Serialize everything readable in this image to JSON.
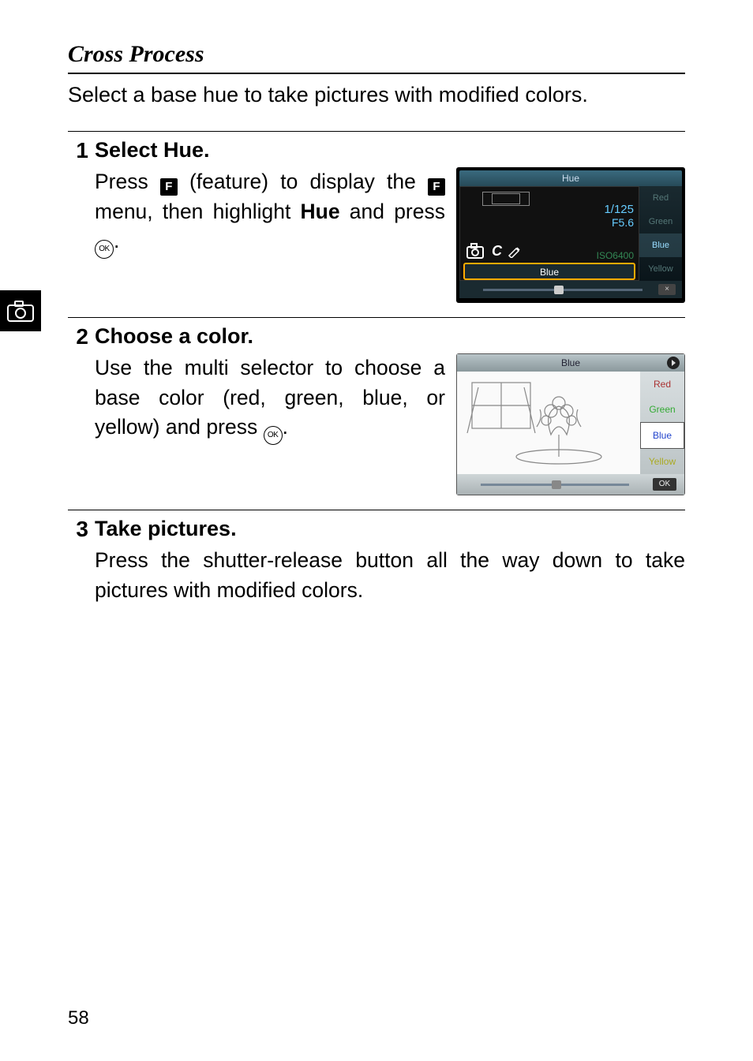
{
  "heading": "Cross Process",
  "intro": "Select a base hue to take pictures with modified colors.",
  "steps": [
    {
      "num": "1",
      "title": "Select Hue.",
      "text_parts": {
        "p1": "Press ",
        "p2": " (feature) to display the ",
        "p3": " menu, then highlight ",
        "hue": "Hue",
        "p4": " and press ",
        "p5": "."
      }
    },
    {
      "num": "2",
      "title": "Choose a color.",
      "text_parts": {
        "p1": "Use the multi selector to choose a base color (red, green, blue, or yellow) and press ",
        "p2": "."
      }
    },
    {
      "num": "3",
      "title": "Take pictures.",
      "text": "Press the shutter-release button all the way down to take pictures with modified colors."
    }
  ],
  "icons": {
    "f_label": "F",
    "ok_label": "OK"
  },
  "screenshot1": {
    "title": "Hue",
    "shutter": "1/125",
    "aperture": "F5.6",
    "iso": "ISO6400",
    "selected": "Blue",
    "options": {
      "red": "Red",
      "green": "Green",
      "blue": "Blue",
      "yellow": "Yellow"
    },
    "close": "×"
  },
  "screenshot2": {
    "title": "Blue",
    "options": {
      "red": "Red",
      "green": "Green",
      "blue": "Blue",
      "yellow": "Yellow"
    },
    "ok": "OK"
  },
  "page_number": "58"
}
